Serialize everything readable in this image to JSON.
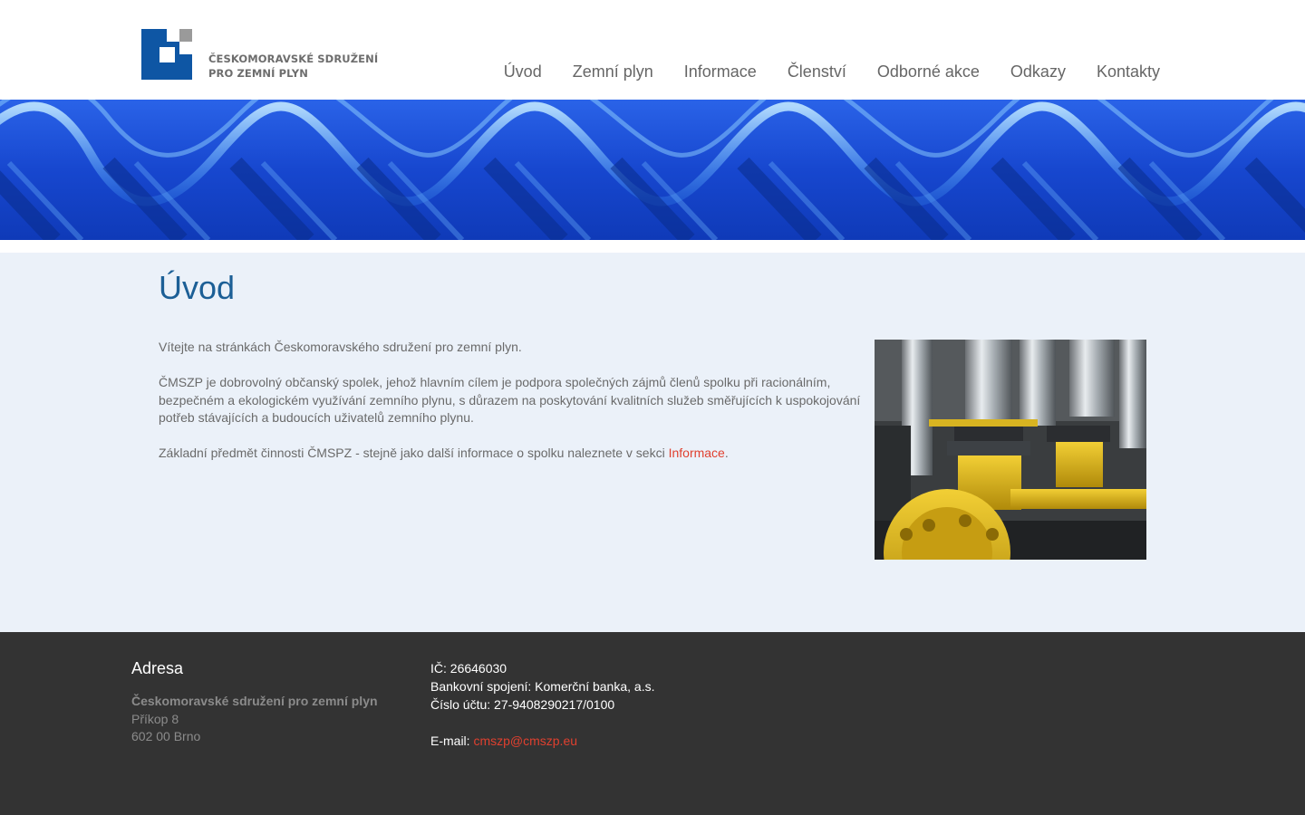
{
  "header": {
    "logo": {
      "line1": "ČESKOMORAVSKÉ SDRUŽENÍ",
      "line2": "PRO ZEMNÍ PLYN",
      "colors": {
        "primary": "#0e56a4",
        "secondary": "#9a9a9a"
      }
    },
    "nav": [
      {
        "label": "Úvod"
      },
      {
        "label": "Zemní plyn"
      },
      {
        "label": "Informace"
      },
      {
        "label": "Členství"
      },
      {
        "label": "Odborné akce"
      },
      {
        "label": "Odkazy"
      },
      {
        "label": "Kontakty"
      }
    ]
  },
  "main": {
    "title": "Úvod",
    "paragraph1": "Vítejte na stránkách Českomoravského sdružení pro zemní plyn.",
    "paragraph2": "ČMSZP je dobrovolný občanský spolek, jehož hlavním cílem je podpora společných zájmů členů spolku při racionálním, bezpečném a ekologickém využívání zemního plynu, s důrazem na poskytování kvalitních služeb směřujících k uspokojování potřeb stávajících a budoucích uživatelů zemního plynu.",
    "paragraph3_prefix": "Základní předmět činnosti ČMSPZ - stejně jako další informace o spolku naleznete v sekci ",
    "paragraph3_link": "Informace",
    "paragraph3_suffix": "."
  },
  "footer": {
    "address_heading": "Adresa",
    "org_name": "Českomoravské sdružení pro zemní plyn",
    "street": "Příkop 8",
    "city": "602 00 Brno",
    "ic": "IČ: 26646030",
    "bank": "Bankovní spojení: Komerční banka, a.s.",
    "account": "Číslo účtu: 27-9408290217/0100",
    "email_label": "E-mail: ",
    "email": "cmszp@cmszp.eu"
  },
  "colors": {
    "title": "#1c5f96",
    "link": "#e0402f",
    "main_bg": "#ebf1f9",
    "footer_bg": "#333333"
  }
}
